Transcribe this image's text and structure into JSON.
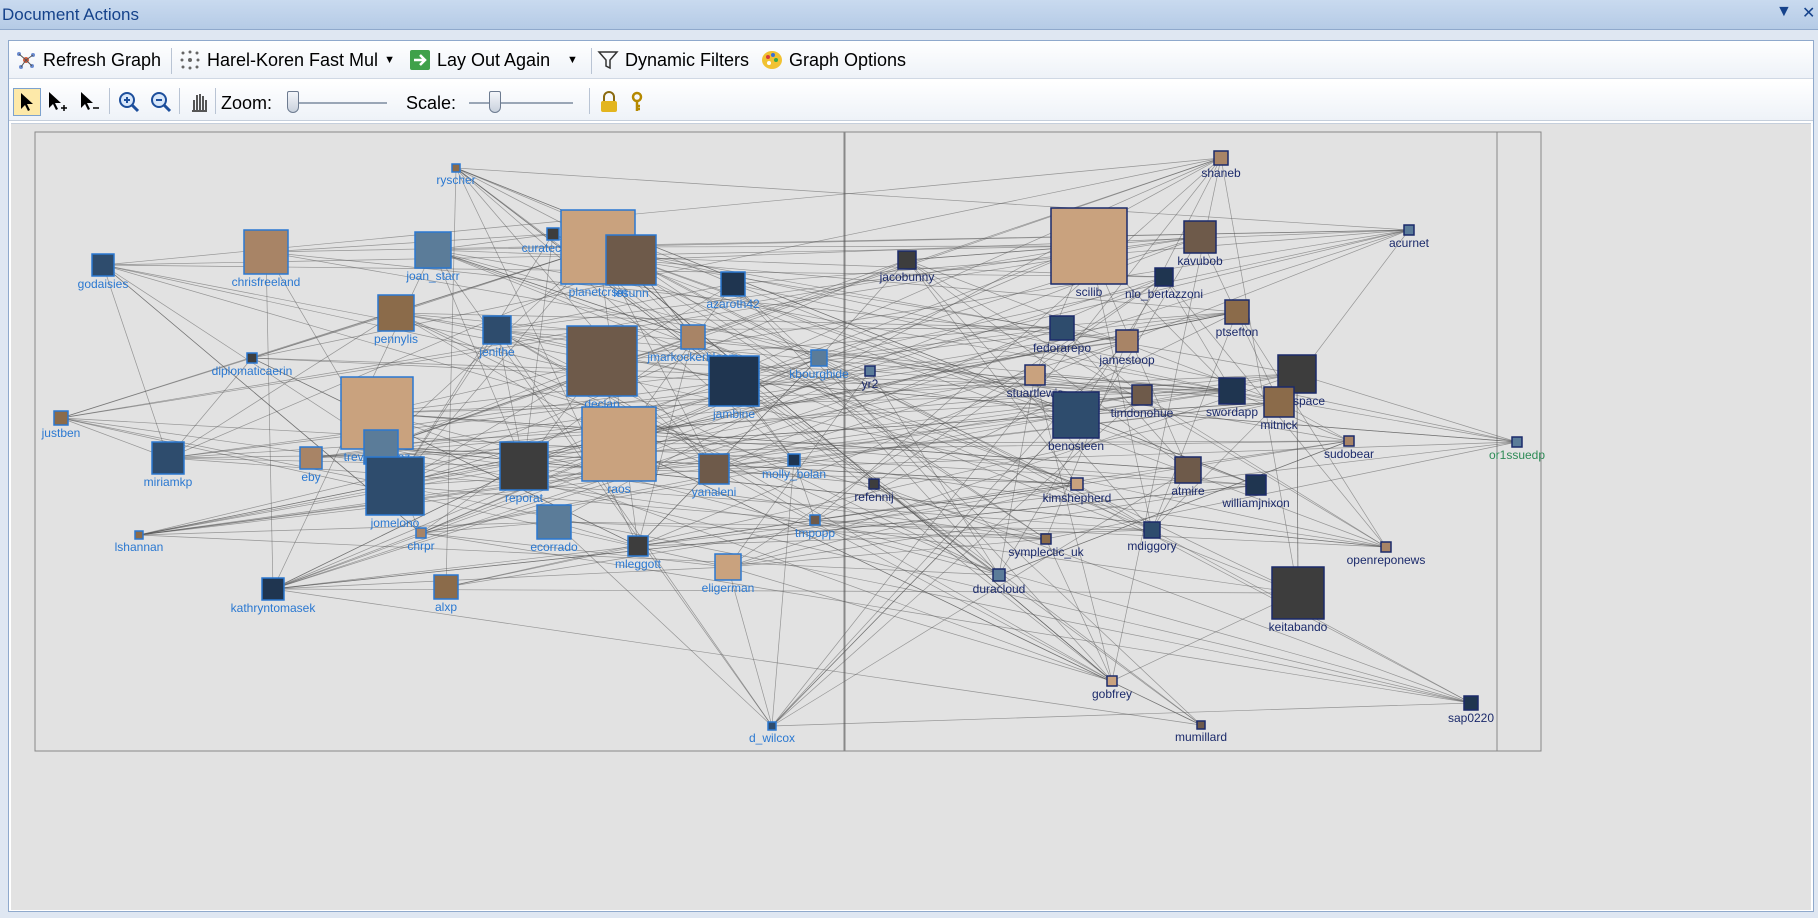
{
  "window": {
    "title": "Document Actions",
    "dropdown_glyph": "▼",
    "close_glyph": "✕"
  },
  "toolbar1": {
    "refresh": {
      "label": "Refresh Graph",
      "icon": "refresh-graph-icon"
    },
    "layout_algorithm": {
      "label": "Harel-Koren Fast Mul",
      "icon": "layout-icon"
    },
    "lay_out_again": {
      "label": "Lay Out Again",
      "icon": "arrow-icon"
    },
    "dynamic_filters": {
      "label": "Dynamic Filters",
      "icon": "funnel-icon"
    },
    "graph_options": {
      "label": "Graph Options",
      "icon": "palette-icon"
    }
  },
  "toolbar2": {
    "zoom_label": "Zoom:",
    "scale_label": "Scale:",
    "zoom_level": 0.0,
    "scale_level": 0.22,
    "tools": [
      "select-icon",
      "add-select-icon",
      "subtract-select-icon",
      "zoom-in-icon",
      "zoom-out-icon",
      "hand-pan-icon",
      "lock-icon",
      "key-icon"
    ]
  },
  "graph": {
    "edge_color": "#555555",
    "label_color": "#2a78d1",
    "group_border": "#888888",
    "nodes": [
      {
        "label": "ryscher",
        "group": 1
      },
      {
        "label": "godaisies",
        "group": 1
      },
      {
        "label": "chrisfreeland",
        "group": 1
      },
      {
        "label": "joan_starr",
        "group": 1
      },
      {
        "label": "curatecamp",
        "group": 1
      },
      {
        "label": "planetcrsm",
        "group": 1
      },
      {
        "label": "iesunn",
        "group": 1
      },
      {
        "label": "azaroth42",
        "group": 1
      },
      {
        "label": "pennylis",
        "group": 1
      },
      {
        "label": "jenithe",
        "group": 1
      },
      {
        "label": "jmarkockerbloom",
        "group": 1
      },
      {
        "label": "kbourghide",
        "group": 1
      },
      {
        "label": "diplomaticaerin",
        "group": 1
      },
      {
        "label": "trevormunoz",
        "group": 1
      },
      {
        "label": "declan",
        "group": 1
      },
      {
        "label": "jambine",
        "group": 1
      },
      {
        "label": "justben",
        "group": 1
      },
      {
        "label": "miriamkp",
        "group": 1
      },
      {
        "label": "eby",
        "group": 1
      },
      {
        "label": "ana",
        "group": 1
      },
      {
        "label": "reporat",
        "group": 1
      },
      {
        "label": "raos",
        "group": 1
      },
      {
        "label": "yanaleni",
        "group": 1
      },
      {
        "label": "molly_bolan",
        "group": 1
      },
      {
        "label": "lshannan",
        "group": 1
      },
      {
        "label": "jomelono",
        "group": 1
      },
      {
        "label": "chrpr",
        "group": 1
      },
      {
        "label": "ecorrado",
        "group": 1
      },
      {
        "label": "mleggott",
        "group": 1
      },
      {
        "label": "eligerman",
        "group": 1
      },
      {
        "label": "tmpopp",
        "group": 1
      },
      {
        "label": "kathryntomasek",
        "group": 1
      },
      {
        "label": "alxp",
        "group": 1
      },
      {
        "label": "d_wilcox",
        "group": 1
      },
      {
        "label": "shaneb",
        "group": 2
      },
      {
        "label": "acurnet",
        "group": 2
      },
      {
        "label": "jacobunny",
        "group": 2
      },
      {
        "label": "scilib",
        "group": 2
      },
      {
        "label": "kavubob",
        "group": 2
      },
      {
        "label": "nlo_bertazzoni",
        "group": 2
      },
      {
        "label": "ptsefton",
        "group": 2
      },
      {
        "label": "fedorarepo",
        "group": 2
      },
      {
        "label": "jamestoop",
        "group": 2
      },
      {
        "label": "yr2",
        "group": 2
      },
      {
        "label": "duraspace",
        "group": 2
      },
      {
        "label": "stuartlewis",
        "group": 2
      },
      {
        "label": "timdonohue",
        "group": 2
      },
      {
        "label": "swordapp",
        "group": 2
      },
      {
        "label": "mitnick",
        "group": 2
      },
      {
        "label": "benosteen",
        "group": 2
      },
      {
        "label": "sudobear",
        "group": 2
      },
      {
        "label": "or1ssuedp",
        "group": 3
      },
      {
        "label": "refennij",
        "group": 2
      },
      {
        "label": "kimshepherd",
        "group": 2
      },
      {
        "label": "atmire",
        "group": 2
      },
      {
        "label": "williamjnixon",
        "group": 2
      },
      {
        "label": "symplectic_uk",
        "group": 2
      },
      {
        "label": "mdiggory",
        "group": 2
      },
      {
        "label": "openreponews",
        "group": 2
      },
      {
        "label": "duracloud",
        "group": 2
      },
      {
        "label": "keitabando",
        "group": 2
      },
      {
        "label": "gobfrey",
        "group": 2
      },
      {
        "label": "mumillard",
        "group": 2
      },
      {
        "label": "sap0220",
        "group": 2
      }
    ]
  }
}
